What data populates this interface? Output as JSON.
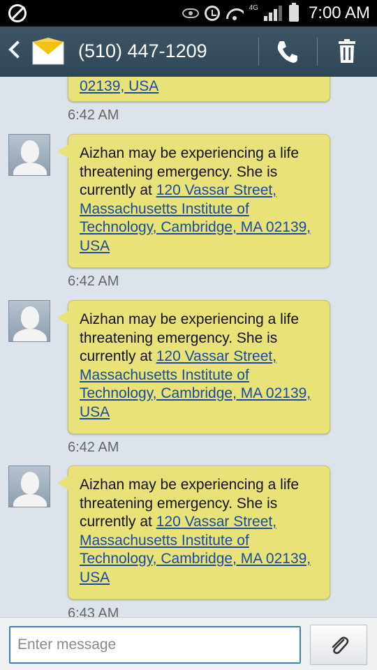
{
  "status_bar": {
    "network_label": "4G",
    "time": "7:00 AM"
  },
  "header": {
    "contact": "(510) 447-1209"
  },
  "conversation": {
    "top_partial": {
      "link_tail": "02139, USA",
      "time": "6:42 AM"
    },
    "messages": [
      {
        "text": "Aizhan may be experiencing a life threatening emergency. She is currently at ",
        "link": "120 Vassar Street, Massachusetts Institute of Technology, Cambridge, MA 02139, USA",
        "time": "6:42 AM"
      },
      {
        "text": "Aizhan may be experiencing a life threatening emergency. She is currently at ",
        "link": "120 Vassar Street, Massachusetts Institute of Technology, Cambridge, MA 02139, USA",
        "time": "6:42 AM"
      },
      {
        "text": "Aizhan may be experiencing a life threatening emergency. She is currently at ",
        "link": "120 Vassar Street, Massachusetts Institute of Technology, Cambridge, MA 02139, USA",
        "time": "6:43 AM"
      }
    ]
  },
  "composer": {
    "placeholder": "Enter message",
    "value": ""
  },
  "icons": {
    "status": [
      "blocked-icon",
      "eye-icon",
      "alarm-icon",
      "wifi-icon",
      "signal-icon",
      "battery-icon"
    ],
    "header": [
      "back-icon",
      "envelope-icon",
      "phone-icon",
      "trash-icon"
    ],
    "composer": [
      "paperclip-icon"
    ]
  },
  "colors": {
    "action_bar": "#34495a",
    "bubble": "#e8e279",
    "link": "#1a4aa0",
    "input_border": "#3b7fc4"
  }
}
